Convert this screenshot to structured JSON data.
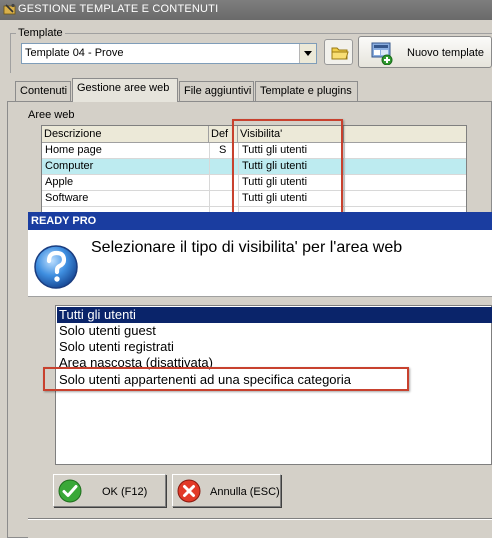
{
  "window": {
    "title": "GESTIONE TEMPLATE E CONTENUTI"
  },
  "template": {
    "label": "Template",
    "selected": "Template 04 - Prove",
    "new_button_label": "Nuovo template"
  },
  "tabs": [
    {
      "label": "Contenuti",
      "active": false
    },
    {
      "label": "Gestione aree web",
      "active": true
    },
    {
      "label": "File aggiuntivi",
      "active": false
    },
    {
      "label": "Template e plugins",
      "active": false
    }
  ],
  "aree": {
    "label": "Aree web",
    "columns": [
      "Descrizione",
      "Def",
      "Visibilita'"
    ],
    "rows": [
      {
        "descrizione": "Home page",
        "def": "S",
        "visibilita": "Tutti gli utenti",
        "selected": false
      },
      {
        "descrizione": "Computer",
        "def": "",
        "visibilita": "Tutti gli utenti",
        "selected": true
      },
      {
        "descrizione": "Apple",
        "def": "",
        "visibilita": "Tutti gli utenti",
        "selected": false
      },
      {
        "descrizione": "Software",
        "def": "",
        "visibilita": "Tutti gli utenti",
        "selected": false
      }
    ]
  },
  "dialog": {
    "title": "READY PRO",
    "question": "Selezionare il tipo di visibilita' per l'area web",
    "options": [
      {
        "label": "Tutti gli utenti",
        "selected": true
      },
      {
        "label": "Solo utenti guest",
        "selected": false
      },
      {
        "label": "Solo utenti registrati",
        "selected": false
      },
      {
        "label": "Area nascosta (disattivata)",
        "selected": false
      },
      {
        "label": "Solo utenti appartenenti ad una specifica categoria",
        "selected": false
      }
    ],
    "ok_label": "OK (F12)",
    "cancel_label": "Annulla (ESC)"
  },
  "colors": {
    "highlight_red": "#c8412e",
    "selected_row": "#bdebf0",
    "list_selection": "#0a246a",
    "dialog_titlebar": "#1a3da0"
  }
}
